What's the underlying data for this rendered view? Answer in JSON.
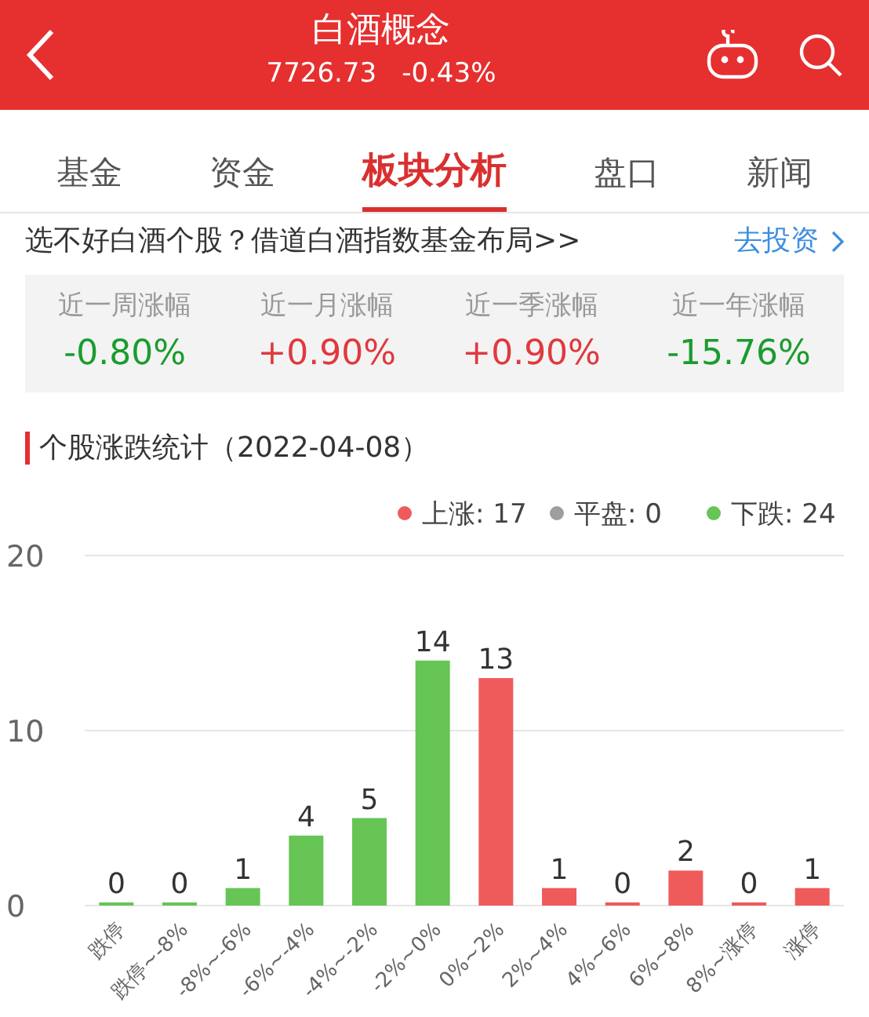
{
  "header": {
    "title": "白酒概念",
    "price": "7726.73",
    "change": "-0.43%"
  },
  "tabs": [
    {
      "label": "基金",
      "selected": false
    },
    {
      "label": "资金",
      "selected": false
    },
    {
      "label": "板块分析",
      "selected": true
    },
    {
      "label": "盘口",
      "selected": false
    },
    {
      "label": "新闻",
      "selected": false
    }
  ],
  "banner": {
    "text": "选不好白酒个股？借道白酒指数基金布局>>",
    "link": "去投资"
  },
  "stats": [
    {
      "label": "近一周涨幅",
      "value": "-0.80%",
      "color": "#1a9c2e"
    },
    {
      "label": "近一月涨幅",
      "value": "+0.90%",
      "color": "#e0393e"
    },
    {
      "label": "近一季涨幅",
      "value": "+0.90%",
      "color": "#e0393e"
    },
    {
      "label": "近一年涨幅",
      "value": "-15.76%",
      "color": "#1a9c2e"
    }
  ],
  "section": {
    "title": "个股涨跌统计（2022-04-08）"
  },
  "legend": [
    {
      "label": "上涨: 17",
      "color": "#ef5b5b"
    },
    {
      "label": "平盘: 0",
      "color": "#9e9e9e"
    },
    {
      "label": "下跌: 24",
      "color": "#66c555"
    }
  ],
  "chart_data": {
    "type": "bar",
    "categories": [
      "跌停",
      "跌停~-8%",
      "-8%~-6%",
      "-6%~-4%",
      "-4%~-2%",
      "-2%~0%",
      "0%~2%",
      "2%~4%",
      "4%~6%",
      "6%~8%",
      "8%~涨停",
      "涨停"
    ],
    "series": [
      {
        "color": "#66c555",
        "values": [
          0,
          0,
          1,
          4,
          5,
          14,
          null,
          null,
          null,
          null,
          null,
          null
        ]
      },
      {
        "color": "#ef5b5b",
        "values": [
          null,
          null,
          null,
          null,
          null,
          null,
          13,
          1,
          0,
          2,
          0,
          1
        ]
      }
    ],
    "ylim": [
      0,
      20
    ],
    "yticks": [
      0,
      10,
      20
    ],
    "data_labels": true
  }
}
